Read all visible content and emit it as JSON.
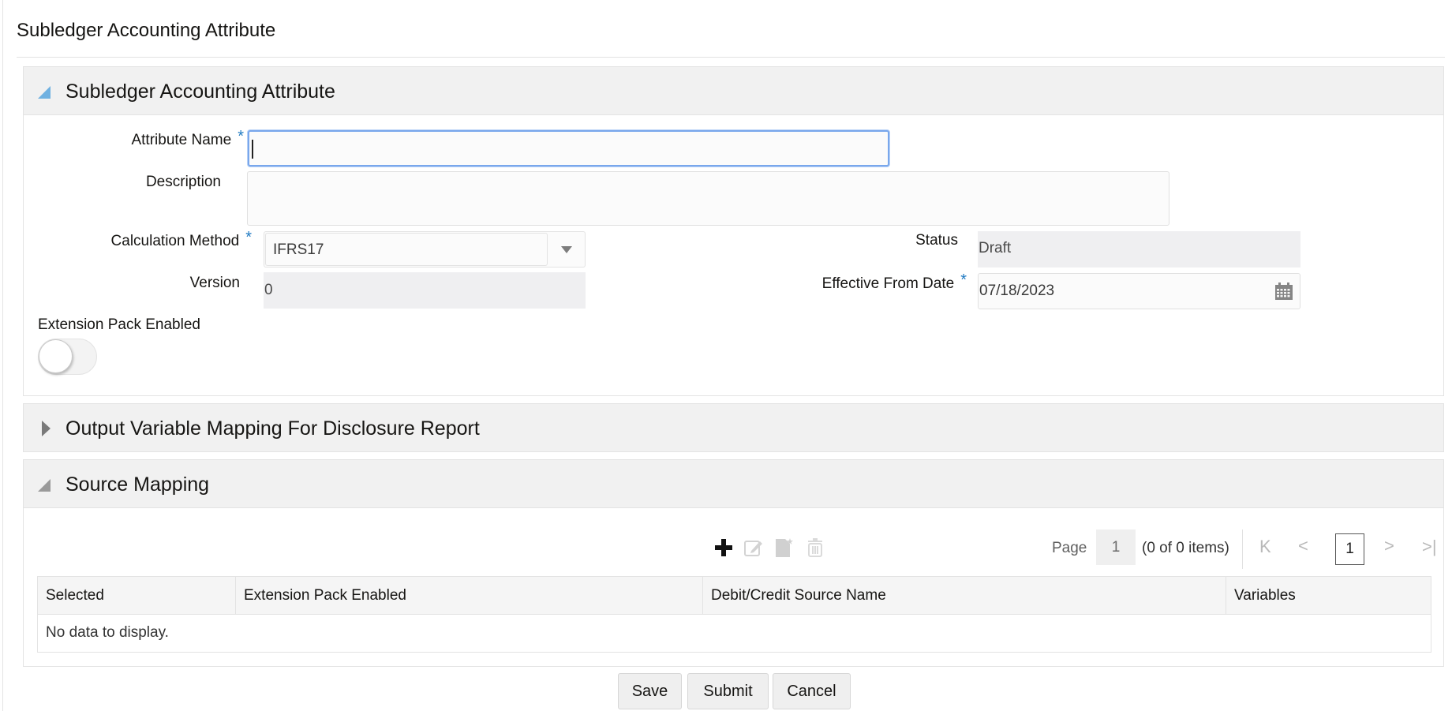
{
  "page": {
    "title": "Subledger Accounting Attribute"
  },
  "sections": {
    "attribute": {
      "title": "Subledger Accounting Attribute",
      "expanded": true,
      "fields": {
        "attribute_name": {
          "label": "Attribute Name",
          "required": "*",
          "value": "",
          "focused": true
        },
        "description": {
          "label": "Description",
          "value": ""
        },
        "calculation_method": {
          "label": "Calculation Method",
          "required": "*",
          "value": "IFRS17"
        },
        "version": {
          "label": "Version",
          "value": "0"
        },
        "status": {
          "label": "Status",
          "value": "Draft"
        },
        "effective_from_date": {
          "label": "Effective From Date",
          "required": "*",
          "value": "07/18/2023"
        },
        "extension_pack_enabled": {
          "label": "Extension Pack Enabled",
          "value": false
        }
      }
    },
    "output_mapping": {
      "title": "Output Variable Mapping For Disclosure Report",
      "expanded": false
    },
    "source_mapping": {
      "title": "Source Mapping",
      "expanded": true,
      "toolbar": {
        "add": "plus-icon",
        "edit": "edit-icon",
        "new_doc": "new-document-icon",
        "delete": "trash-icon"
      },
      "pagination": {
        "page_label": "Page",
        "page_value": "1",
        "items_text": "(0 of 0 items)",
        "current_page": "1"
      },
      "table": {
        "columns": [
          "Selected",
          "Extension Pack Enabled",
          "Debit/Credit Source Name",
          "Variables"
        ],
        "rows": [],
        "empty_text": "No data to display."
      }
    }
  },
  "actions": {
    "save": "Save",
    "submit": "Submit",
    "cancel": "Cancel"
  },
  "colors": {
    "accent": "#6fb1e1",
    "focus_border": "#79a7ec",
    "required": "#227bc2",
    "header_bg": "#f1f1f1"
  }
}
